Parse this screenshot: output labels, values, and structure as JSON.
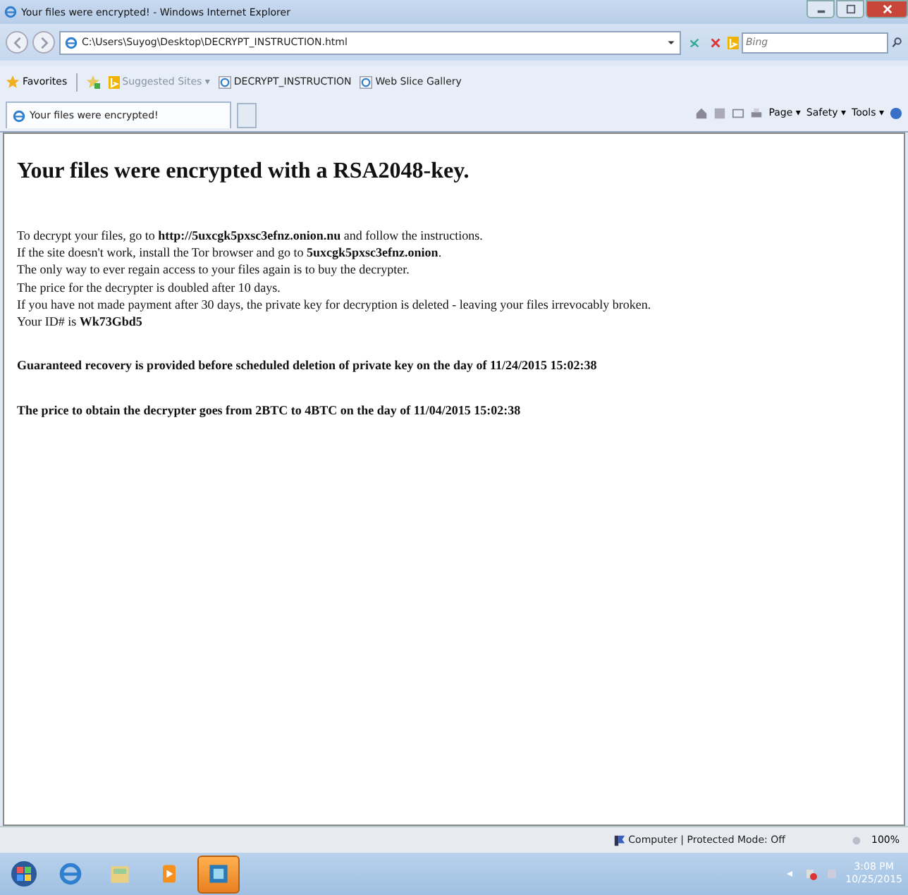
{
  "window": {
    "title": "Your files were encrypted! - Windows Internet Explorer"
  },
  "address_bar": {
    "url": "C:\\Users\\Suyog\\Desktop\\DECRYPT_INSTRUCTION.html",
    "search_placeholder": "Bing"
  },
  "favorites_bar": {
    "label": "Favorites",
    "items": [
      {
        "label": "Suggested Sites ▾",
        "disabled": true,
        "kind": "bing"
      },
      {
        "label": "DECRYPT_INSTRUCTION",
        "disabled": false,
        "kind": "page"
      },
      {
        "label": "Web Slice Gallery",
        "disabled": false,
        "kind": "page"
      }
    ]
  },
  "tabs": [
    {
      "label": "Your files were encrypted!",
      "selected": true
    }
  ],
  "command_bar": [
    "Page ▾",
    "Safety ▾",
    "Tools ▾"
  ],
  "page": {
    "heading": "Your files were encrypted with a RSA2048-key.",
    "lines": [
      "To decrypt your files, go to **http://5uxcgk5pxsc3efnz.onion.nu** and follow the instructions.",
      "If the site doesn't work, install the Tor browser and go to **5uxcgk5pxsc3efnz.onion**.",
      "The only way to ever regain access to your files again is to buy the decrypter.",
      "The price for the decrypter is doubled after 10 days.",
      "If you have not made payment after 30 days, the private key for decryption is deleted - leaving your files irrevocably broken.",
      "Your ID# is **Wk73Gbd5**"
    ],
    "notices": [
      "Guaranteed recovery is provided before scheduled deletion of private key on the day of 11/24/2015 15:02:38",
      "The price to obtain the decrypter goes from 2BTC to 4BTC on the day of 11/04/2015 15:02:38"
    ]
  },
  "status_bar": {
    "zone": "Computer | Protected Mode: Off",
    "zoom": "100%"
  },
  "taskbar": {
    "items": [
      {
        "kind": "ie",
        "active": false
      },
      {
        "kind": "folder",
        "active": false
      },
      {
        "kind": "media",
        "active": false
      },
      {
        "kind": "app",
        "active": true
      }
    ],
    "time": "3:08 PM",
    "date": "10/25/2015"
  }
}
